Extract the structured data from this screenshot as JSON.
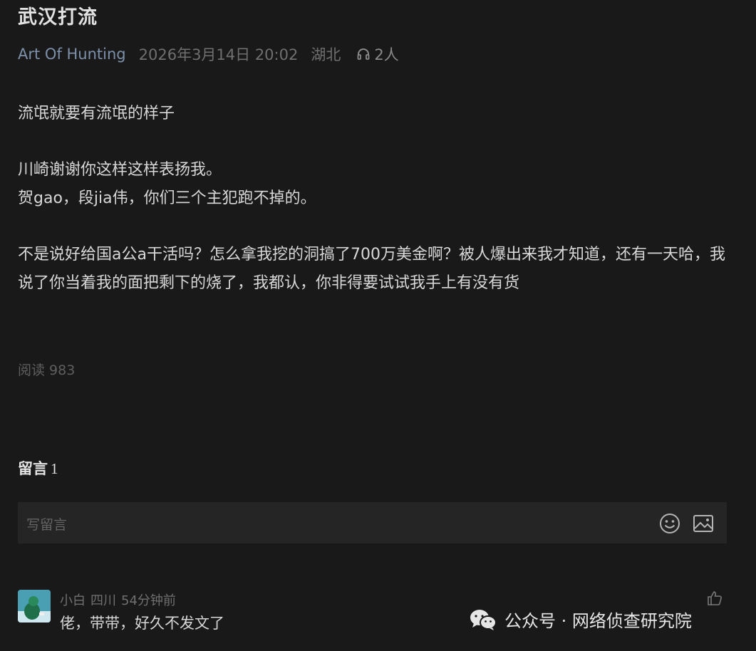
{
  "article": {
    "title": "武汉打流",
    "author": "Art Of Hunting",
    "date": "2026年3月14日 20:02",
    "region": "湖北",
    "listeners": "2人"
  },
  "body": {
    "p1": "流氓就要有流氓的样子",
    "p2": "川崎谢谢你这样这样表扬我。",
    "p3": "贺gao，段jia伟，你们三个主犯跑不掉的。",
    "p4": "不是说好给国a公a干活吗？怎么拿我挖的洞搞了700万美金啊？被人爆出来我才知道，还有一天哈，我说了你当着我的面把剩下的烧了，我都认，你非得要试试我手上有没有货"
  },
  "stats": {
    "read_label": "阅读",
    "read_count": "983"
  },
  "comments_section": {
    "label": "留言",
    "count": "1",
    "input_placeholder": "写留言"
  },
  "comments": [
    {
      "user": "小白",
      "location": "四川",
      "time": "54分钟前",
      "text": "佬，带带，好久不发文了"
    }
  ],
  "watermark": {
    "text": "公众号 · 网络侦查研究院"
  },
  "icons": {
    "listen": "headphones-icon",
    "emoji": "emoji-icon",
    "image": "image-icon",
    "like": "thumbs-up-icon",
    "wechat": "wechat-icon"
  },
  "colors": {
    "background": "#191919",
    "author_link": "#7d90aa",
    "input_background": "#252525"
  }
}
